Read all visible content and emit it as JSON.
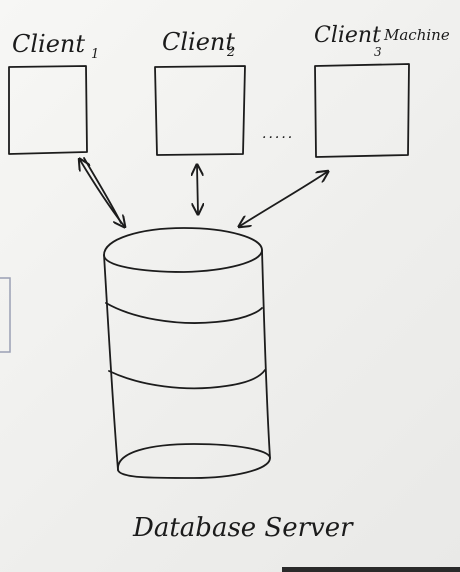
{
  "nodes": [
    {
      "id": "client1",
      "label": "Client",
      "subscript": "1"
    },
    {
      "id": "client2",
      "label": "Client",
      "subscript": "2"
    },
    {
      "id": "client3",
      "label": "Client",
      "subscript": "3",
      "suffix": "Machine"
    }
  ],
  "ellipsis": "·····",
  "database": {
    "label": "Database Server"
  },
  "edges": [
    {
      "from": "client1",
      "to": "database",
      "direction": "bidirectional"
    },
    {
      "from": "client2",
      "to": "database",
      "direction": "bidirectional"
    },
    {
      "from": "client3",
      "to": "database",
      "direction": "bidirectional"
    }
  ]
}
